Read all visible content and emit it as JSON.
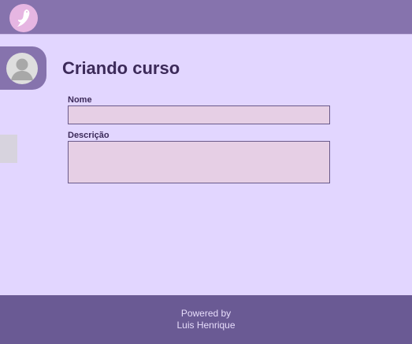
{
  "header": {
    "logo_icon": "bird-logo-icon"
  },
  "sidebar": {
    "avatar_icon": "user-avatar-icon"
  },
  "main": {
    "title": "Criando curso",
    "fields": {
      "name": {
        "label": "Nome",
        "value": "",
        "placeholder": ""
      },
      "description": {
        "label": "Descrição",
        "value": "",
        "placeholder": ""
      }
    }
  },
  "footer": {
    "line1": "Powered by",
    "line2": "Luis Henrique"
  },
  "colors": {
    "header_bg": "#8673ad",
    "page_bg": "#e2d6ff",
    "input_bg": "#e6cfe5",
    "footer_bg": "#6a5a94",
    "title_text": "#3c2a59"
  }
}
